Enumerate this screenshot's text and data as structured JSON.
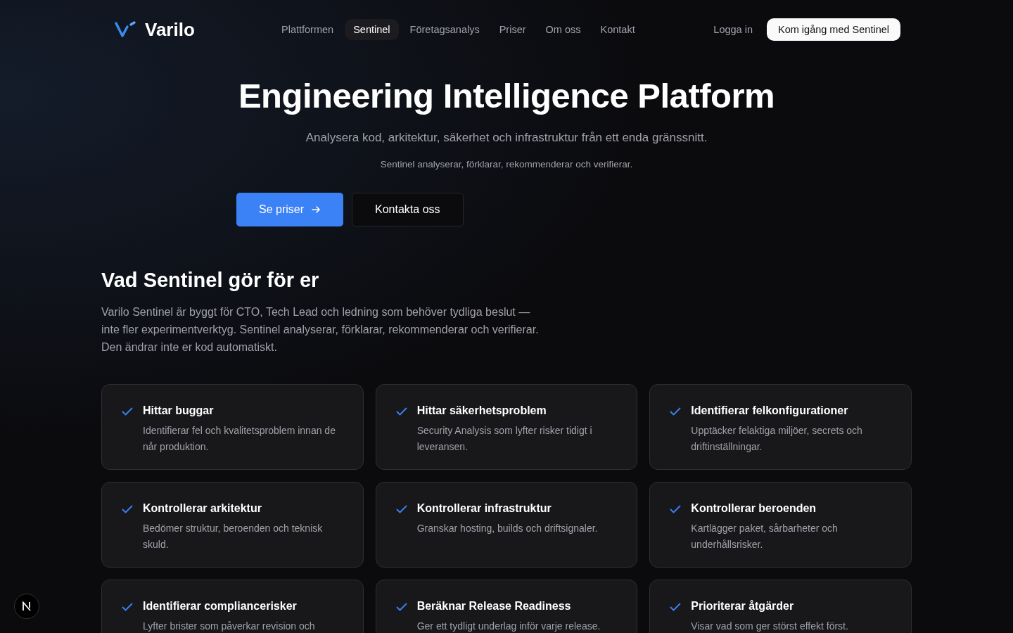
{
  "brand": "Varilo",
  "nav": [
    {
      "label": "Plattformen",
      "selected": false
    },
    {
      "label": "Sentinel",
      "selected": true
    },
    {
      "label": "Företagsanalys",
      "selected": false
    },
    {
      "label": "Priser",
      "selected": false
    },
    {
      "label": "Om oss",
      "selected": false
    },
    {
      "label": "Kontakt",
      "selected": false
    }
  ],
  "login": "Logga in",
  "cta": "Kom igång med Sentinel",
  "hero": {
    "title": "Engineering Intelligence Platform",
    "subtitle": "Analysera kod, arkitektur, säkerhet och infrastruktur från ett enda gränssnitt.",
    "tagline": "Sentinel analyserar, förklarar, rekommenderar och verifierar.",
    "primary": "Se priser",
    "secondary": "Kontakta oss"
  },
  "section": {
    "title": "Vad Sentinel gör för er",
    "lines": [
      "Varilo Sentinel är byggt för CTO, Tech Lead och ledning som behöver tydliga beslut —",
      "inte fler experimentverktyg. Sentinel analyserar, förklarar, rekommenderar och verifierar.",
      "Den ändrar inte er kod automatiskt."
    ]
  },
  "features": [
    {
      "title": "Hittar buggar",
      "text": "Identifierar fel och kvalitetsproblem innan de når produktion."
    },
    {
      "title": "Hittar säkerhetsproblem",
      "text": "Security Analysis som lyfter risker tidigt i leveransen."
    },
    {
      "title": "Identifierar felkonfigurationer",
      "text": "Upptäcker felaktiga miljöer, secrets och driftinställningar."
    },
    {
      "title": "Kontrollerar arkitektur",
      "text": "Bedömer struktur, beroenden och teknisk skuld."
    },
    {
      "title": "Kontrollerar infrastruktur",
      "text": "Granskar hosting, builds och driftsignaler."
    },
    {
      "title": "Kontrollerar beroenden",
      "text": "Kartlägger paket, sårbarheter och underhållsrisker."
    },
    {
      "title": "Identifierar compliancerisker",
      "text": "Lyfter brister som påverkar revision och"
    },
    {
      "title": "Beräknar Release Readiness",
      "text": "Ger ett tydligt underlag inför varje release."
    },
    {
      "title": "Prioriterar åtgärder",
      "text": "Visar vad som ger störst effekt först."
    }
  ]
}
